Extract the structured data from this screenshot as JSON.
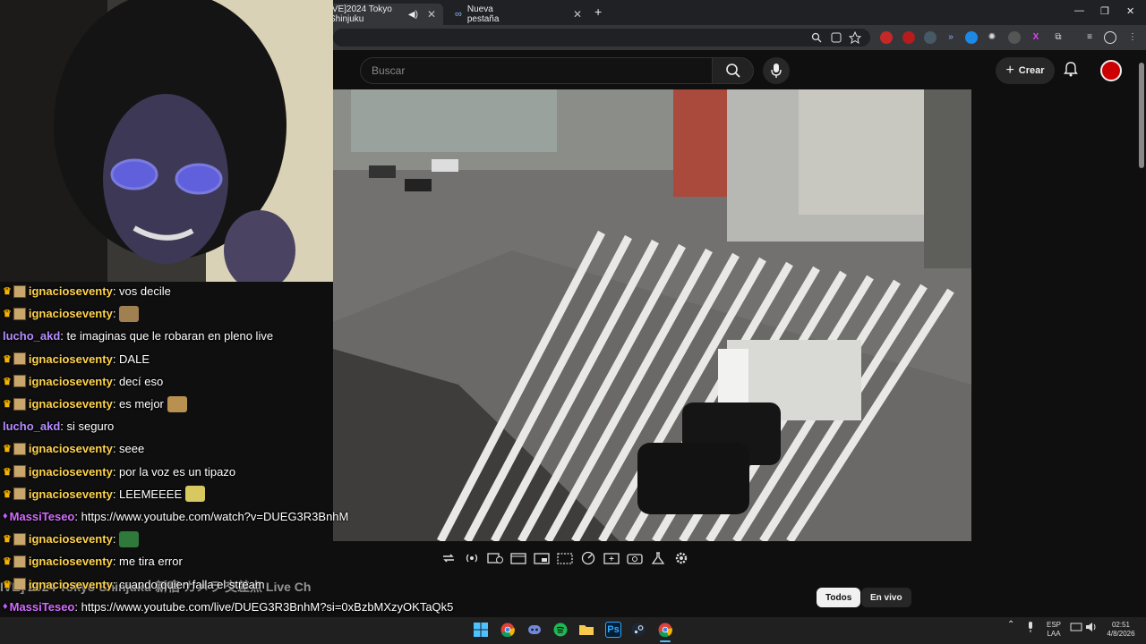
{
  "browser": {
    "tabs": [
      {
        "title": "IVE]2024 Tokyo Shinjuku",
        "active": true
      },
      {
        "title": "Nueva pestaña",
        "active": false
      }
    ],
    "new_tab_symbol": "+",
    "window_controls": [
      "—",
      "❐",
      "✕"
    ]
  },
  "youtube": {
    "search_placeholder": "Buscar",
    "create_label": "Crear",
    "chips": [
      "Todos",
      "En vivo"
    ]
  },
  "video": {
    "controls": [
      "loop-icon",
      "live-icon",
      "watch-later-icon",
      "theater-icon",
      "miniplayer-icon",
      "captions-icon",
      "speed-icon",
      "clip-icon",
      "screenshot-icon",
      "labs-icon",
      "settings-icon"
    ]
  },
  "chat": {
    "messages": [
      {
        "user": "ignacioseventy",
        "text": ": vos decile",
        "type": "i"
      },
      {
        "user": "ignacioseventy",
        "text": ":",
        "type": "i",
        "emote": "#a08050"
      },
      {
        "user": "lucho_akd",
        "text": ": te imaginas que le robaran en pleno live",
        "type": "l"
      },
      {
        "user": "ignacioseventy",
        "text": ": DALE",
        "type": "i"
      },
      {
        "user": "ignacioseventy",
        "text": ": decí eso",
        "type": "i"
      },
      {
        "user": "ignacioseventy",
        "text": ": es mejor",
        "type": "i",
        "emote": "#b89050"
      },
      {
        "user": "lucho_akd",
        "text": ": si seguro",
        "type": "l"
      },
      {
        "user": "ignacioseventy",
        "text": ": seee",
        "type": "i"
      },
      {
        "user": "ignacioseventy",
        "text": ": por la voz es un tipazo",
        "type": "i"
      },
      {
        "user": "ignacioseventy",
        "text": ": LEEMEEEE",
        "type": "i",
        "emote": "#d8c860"
      },
      {
        "user": "MassiTeseo",
        "text": ": https://www.youtube.com/watch?v=DUEG3R3BnhM",
        "type": "m"
      },
      {
        "user": "ignacioseventy",
        "text": ":",
        "type": "i",
        "emote": "#2f7a3a"
      },
      {
        "user": "ignacioseventy",
        "text": ": me tira error",
        "type": "i"
      },
      {
        "user": "ignacioseventy",
        "text": ": cuando quien falla el stream",
        "type": "i"
      },
      {
        "user": "MassiTeseo",
        "text": ": https://www.youtube.com/live/DUEG3R3BnhM?si=0xBzbMXzyOKTaQk5",
        "type": "m"
      },
      {
        "user": "ignacioseventy",
        "text": ": a ver",
        "type": "i"
      }
    ],
    "ghost_title": "IVE] 2024 Tokyo Shinjuku 新宿 カメラ 交差点 Live Ch"
  },
  "taskbar": {
    "lang_top": "ESP",
    "lang_bottom": "LAA",
    "time": "02:51",
    "date": "4/8/2026",
    "apps": [
      "windows-icon",
      "chrome-icon",
      "discord-icon",
      "spotify-icon",
      "folder-icon",
      "photoshop-icon",
      "steam-icon",
      "chrome-active-icon"
    ],
    "photoshop_label": "Ps"
  },
  "colors": {
    "accent_red": "#cc0000",
    "chat_gold": "#ffd34d",
    "chat_purple": "#b58cff"
  }
}
